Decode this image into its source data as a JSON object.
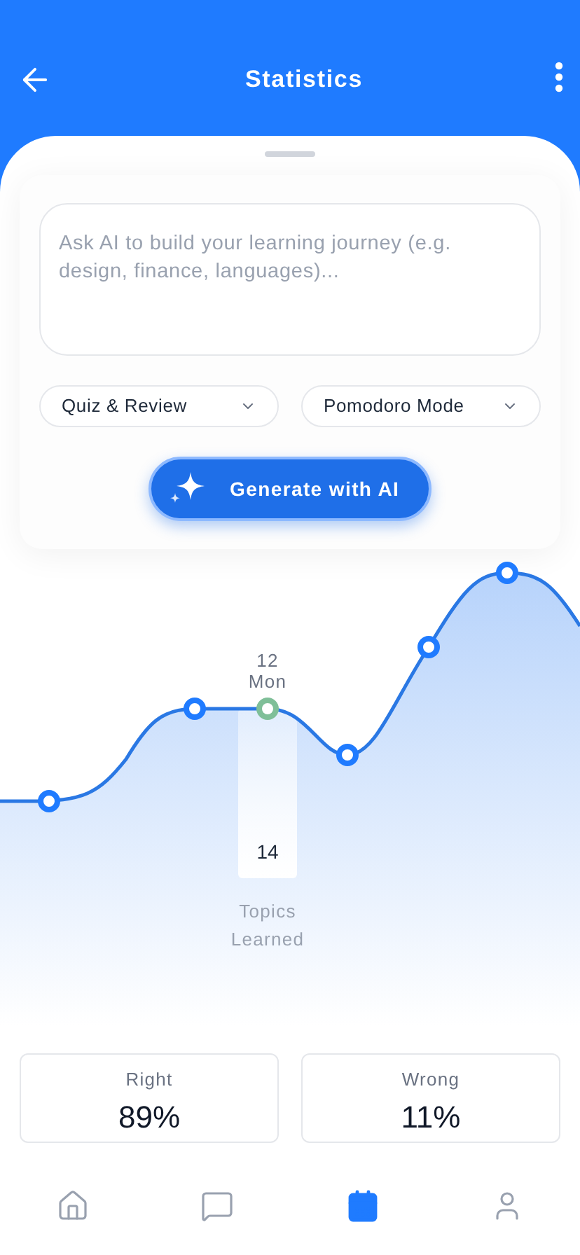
{
  "header": {
    "title": "Statistics"
  },
  "prompt": {
    "placeholder": "Ask AI to build your learning journey (e.g. design, finance, languages)..."
  },
  "dropdowns": [
    {
      "value": "Quiz & Review"
    },
    {
      "value": "Pomodoro Mode"
    }
  ],
  "generate_button": {
    "label": "Generate with AI"
  },
  "chart": {
    "tooltip": {
      "day_number": "12",
      "day_name": "Mon",
      "value": "14",
      "caption_lines": [
        "Topics",
        "Learned"
      ]
    }
  },
  "stats": [
    {
      "label": "Right",
      "value": "89%"
    },
    {
      "label": "Wrong",
      "value": "11%"
    }
  ],
  "nav": [
    {
      "kind": "home",
      "selected": false
    },
    {
      "kind": "chat",
      "selected": false
    },
    {
      "kind": "calendar",
      "selected": true
    },
    {
      "kind": "profile",
      "selected": false
    }
  ]
}
